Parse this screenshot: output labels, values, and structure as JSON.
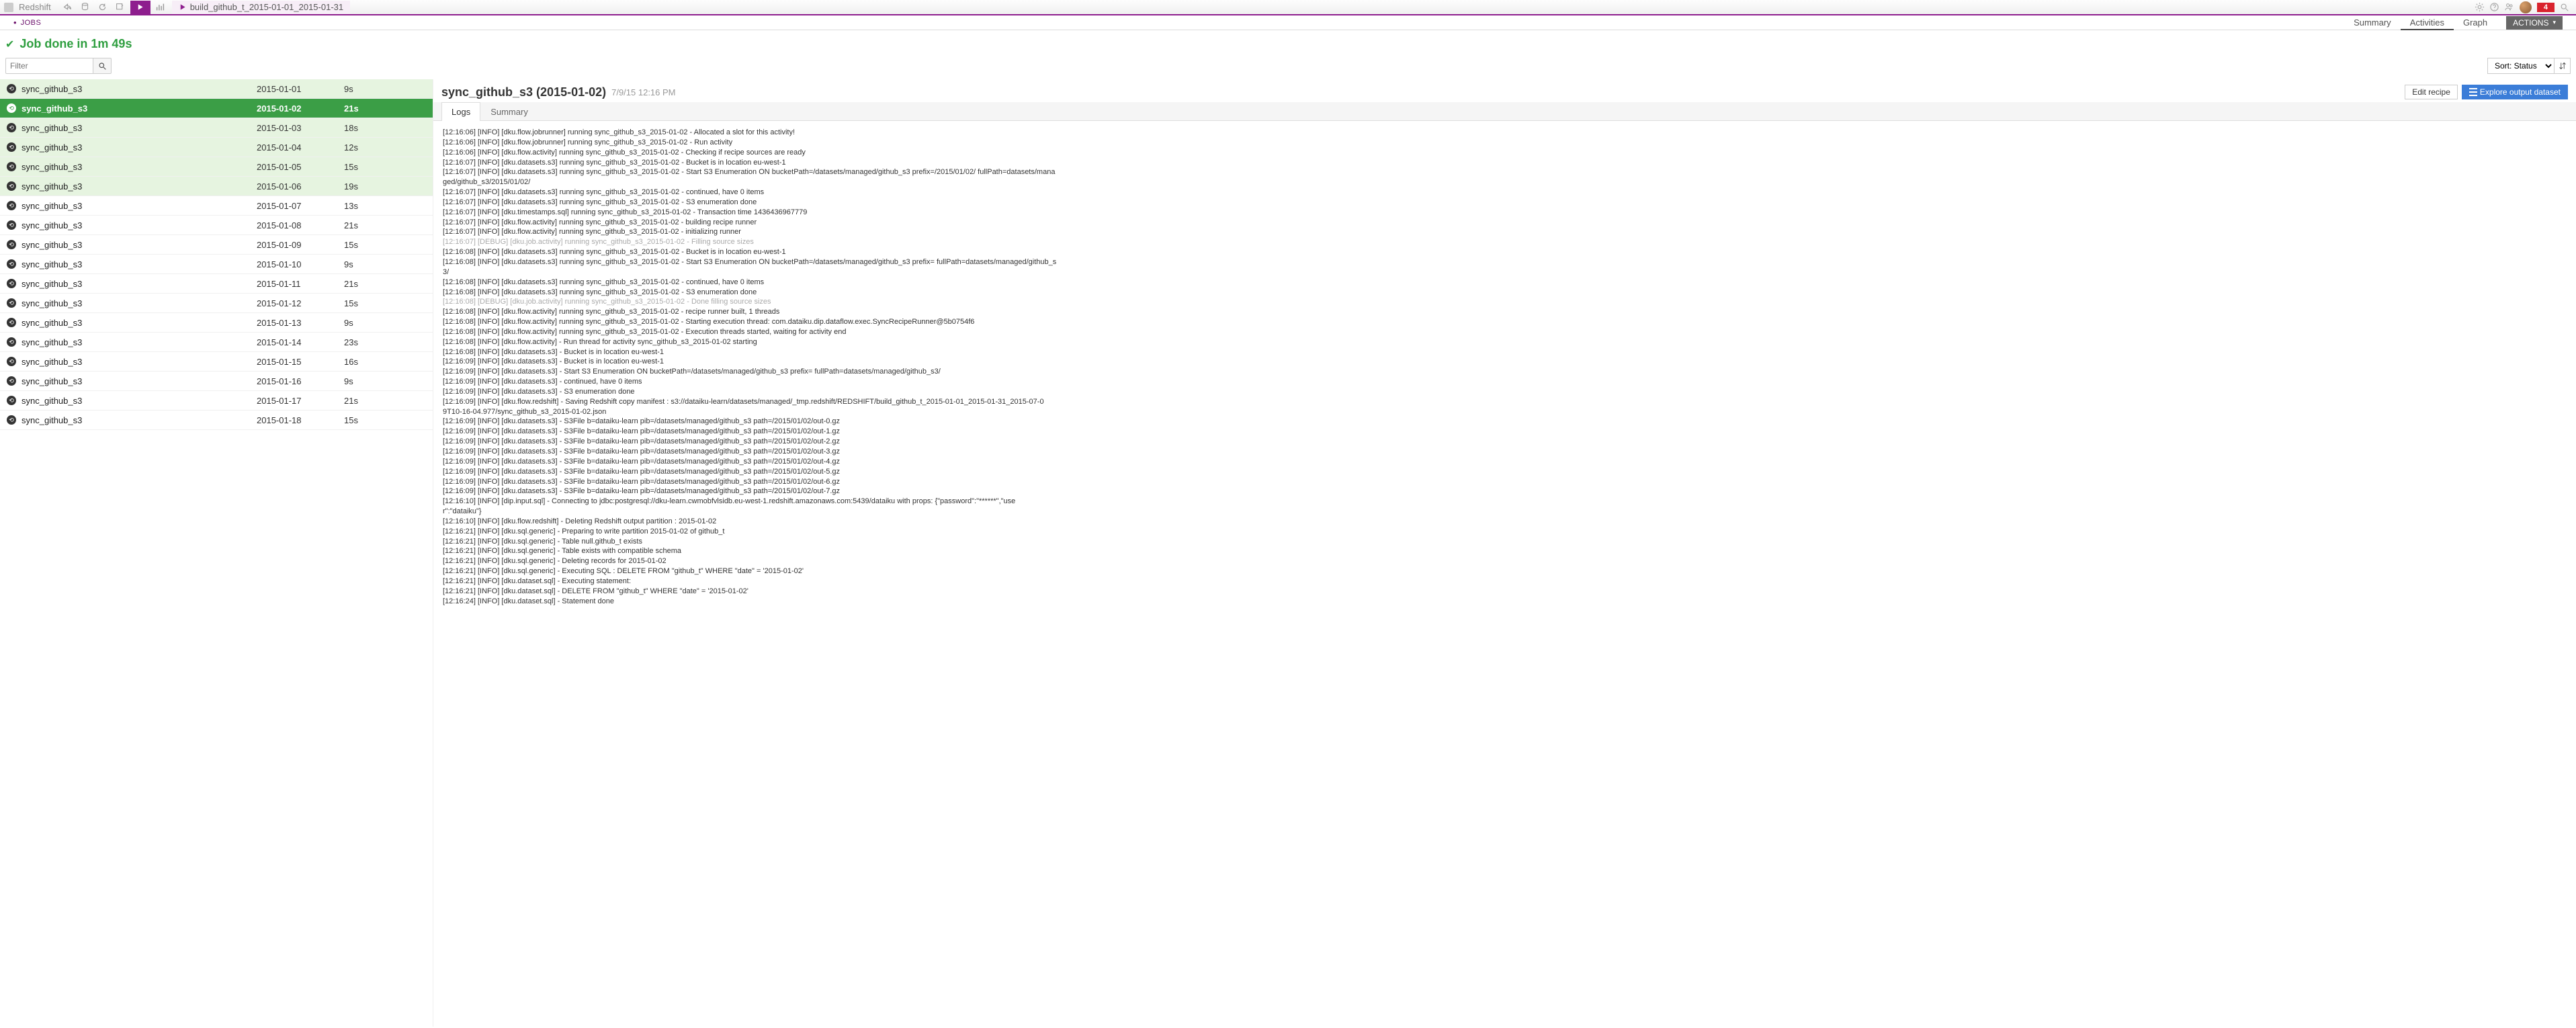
{
  "topbar": {
    "title": "Redshift",
    "crumb": "build_github_t_2015-01-01_2015-01-31",
    "badge": "4"
  },
  "subnav": {
    "jobs": "JOBS",
    "tabs": [
      "Summary",
      "Activities",
      "Graph"
    ],
    "active": "Activities",
    "actions": "ACTIONS"
  },
  "status": "Job done in 1m 49s",
  "filter": {
    "placeholder": "Filter"
  },
  "sort": {
    "label": "Sort: Status"
  },
  "activities": [
    {
      "name": "sync_github_s3",
      "date": "2015-01-01",
      "dur": "9s",
      "done": true
    },
    {
      "name": "sync_github_s3",
      "date": "2015-01-02",
      "dur": "21s",
      "done": true,
      "selected": true
    },
    {
      "name": "sync_github_s3",
      "date": "2015-01-03",
      "dur": "18s",
      "done": true
    },
    {
      "name": "sync_github_s3",
      "date": "2015-01-04",
      "dur": "12s",
      "done": true
    },
    {
      "name": "sync_github_s3",
      "date": "2015-01-05",
      "dur": "15s",
      "done": true
    },
    {
      "name": "sync_github_s3",
      "date": "2015-01-06",
      "dur": "19s",
      "done": true
    },
    {
      "name": "sync_github_s3",
      "date": "2015-01-07",
      "dur": "13s"
    },
    {
      "name": "sync_github_s3",
      "date": "2015-01-08",
      "dur": "21s"
    },
    {
      "name": "sync_github_s3",
      "date": "2015-01-09",
      "dur": "15s"
    },
    {
      "name": "sync_github_s3",
      "date": "2015-01-10",
      "dur": "9s"
    },
    {
      "name": "sync_github_s3",
      "date": "2015-01-11",
      "dur": "21s"
    },
    {
      "name": "sync_github_s3",
      "date": "2015-01-12",
      "dur": "15s"
    },
    {
      "name": "sync_github_s3",
      "date": "2015-01-13",
      "dur": "9s"
    },
    {
      "name": "sync_github_s3",
      "date": "2015-01-14",
      "dur": "23s"
    },
    {
      "name": "sync_github_s3",
      "date": "2015-01-15",
      "dur": "16s"
    },
    {
      "name": "sync_github_s3",
      "date": "2015-01-16",
      "dur": "9s"
    },
    {
      "name": "sync_github_s3",
      "date": "2015-01-17",
      "dur": "21s"
    },
    {
      "name": "sync_github_s3",
      "date": "2015-01-18",
      "dur": "15s"
    }
  ],
  "detail": {
    "title": "sync_github_s3 (2015-01-02)",
    "ts": "7/9/15 12:16 PM",
    "edit": "Edit recipe",
    "explore": "Explore output dataset",
    "tabs": [
      "Logs",
      "Summary"
    ],
    "active": "Logs",
    "log_lines": [
      "[12:16:06] [INFO] [dku.flow.jobrunner] running sync_github_s3_2015-01-02 - Allocated a slot for this activity!",
      "[12:16:06] [INFO] [dku.flow.jobrunner] running sync_github_s3_2015-01-02 - Run activity",
      "[12:16:06] [INFO] [dku.flow.activity] running sync_github_s3_2015-01-02 - Checking if recipe sources are ready",
      "[12:16:07] [INFO] [dku.datasets.s3] running sync_github_s3_2015-01-02 - Bucket is in location eu-west-1",
      "[12:16:07] [INFO] [dku.datasets.s3] running sync_github_s3_2015-01-02 - Start S3 Enumeration ON bucketPath=/datasets/managed/github_s3 prefix=/2015/01/02/ fullPath=datasets/mana",
      "ged/github_s3/2015/01/02/",
      "[12:16:07] [INFO] [dku.datasets.s3] running sync_github_s3_2015-01-02 - continued, have 0 items",
      "[12:16:07] [INFO] [dku.datasets.s3] running sync_github_s3_2015-01-02 - S3 enumeration done",
      "[12:16:07] [INFO] [dku.timestamps.sql] running sync_github_s3_2015-01-02 - Transaction time 1436436967779",
      "[12:16:07] [INFO] [dku.flow.activity] running sync_github_s3_2015-01-02 - building recipe runner",
      "[12:16:07] [INFO] [dku.flow.activity] running sync_github_s3_2015-01-02 - initializing runner",
      "[12:16:07] [DEBUG] [dku.job.activity] running sync_github_s3_2015-01-02 - Filling source sizes",
      "[12:16:08] [INFO] [dku.datasets.s3] running sync_github_s3_2015-01-02 - Bucket is in location eu-west-1",
      "[12:16:08] [INFO] [dku.datasets.s3] running sync_github_s3_2015-01-02 - Start S3 Enumeration ON bucketPath=/datasets/managed/github_s3 prefix= fullPath=datasets/managed/github_s",
      "3/",
      "[12:16:08] [INFO] [dku.datasets.s3] running sync_github_s3_2015-01-02 - continued, have 0 items",
      "[12:16:08] [INFO] [dku.datasets.s3] running sync_github_s3_2015-01-02 - S3 enumeration done",
      "[12:16:08] [DEBUG] [dku.job.activity] running sync_github_s3_2015-01-02 - Done filling source sizes",
      "[12:16:08] [INFO] [dku.flow.activity] running sync_github_s3_2015-01-02 - recipe runner built, 1 threads",
      "[12:16:08] [INFO] [dku.flow.activity] running sync_github_s3_2015-01-02 - Starting execution thread: com.dataiku.dip.dataflow.exec.SyncRecipeRunner@5b0754f6",
      "[12:16:08] [INFO] [dku.flow.activity] running sync_github_s3_2015-01-02 - Execution threads started, waiting for activity end",
      "[12:16:08] [INFO] [dku.flow.activity] - Run thread for activity sync_github_s3_2015-01-02 starting",
      "[12:16:08] [INFO] [dku.datasets.s3] - Bucket is in location eu-west-1",
      "[12:16:09] [INFO] [dku.datasets.s3] - Bucket is in location eu-west-1",
      "[12:16:09] [INFO] [dku.datasets.s3] - Start S3 Enumeration ON bucketPath=/datasets/managed/github_s3 prefix= fullPath=datasets/managed/github_s3/",
      "[12:16:09] [INFO] [dku.datasets.s3] - continued, have 0 items",
      "[12:16:09] [INFO] [dku.datasets.s3] - S3 enumeration done",
      "[12:16:09] [INFO] [dku.flow.redshift] - Saving Redshift copy manifest : s3://dataiku-learn/datasets/managed/_tmp.redshift/REDSHIFT/build_github_t_2015-01-01_2015-01-31_2015-07-0",
      "9T10-16-04.977/sync_github_s3_2015-01-02.json",
      "[12:16:09] [INFO] [dku.datasets.s3] - S3File b=dataiku-learn pib=/datasets/managed/github_s3 path=/2015/01/02/out-0.gz",
      "[12:16:09] [INFO] [dku.datasets.s3] - S3File b=dataiku-learn pib=/datasets/managed/github_s3 path=/2015/01/02/out-1.gz",
      "[12:16:09] [INFO] [dku.datasets.s3] - S3File b=dataiku-learn pib=/datasets/managed/github_s3 path=/2015/01/02/out-2.gz",
      "[12:16:09] [INFO] [dku.datasets.s3] - S3File b=dataiku-learn pib=/datasets/managed/github_s3 path=/2015/01/02/out-3.gz",
      "[12:16:09] [INFO] [dku.datasets.s3] - S3File b=dataiku-learn pib=/datasets/managed/github_s3 path=/2015/01/02/out-4.gz",
      "[12:16:09] [INFO] [dku.datasets.s3] - S3File b=dataiku-learn pib=/datasets/managed/github_s3 path=/2015/01/02/out-5.gz",
      "[12:16:09] [INFO] [dku.datasets.s3] - S3File b=dataiku-learn pib=/datasets/managed/github_s3 path=/2015/01/02/out-6.gz",
      "[12:16:09] [INFO] [dku.datasets.s3] - S3File b=dataiku-learn pib=/datasets/managed/github_s3 path=/2015/01/02/out-7.gz",
      "[12:16:10] [INFO] [dip.input.sql] - Connecting to jdbc:postgresql://dku-learn.cwmobfvlsidb.eu-west-1.redshift.amazonaws.com:5439/dataiku with props: {\"password\":\"******\",\"use",
      "r\":\"dataiku\"}",
      "[12:16:10] [INFO] [dku.flow.redshift] - Deleting Redshift output partition : 2015-01-02",
      "[12:16:21] [INFO] [dku.sql.generic] - Preparing to write partition 2015-01-02 of github_t",
      "[12:16:21] [INFO] [dku.sql.generic] - Table null.github_t exists",
      "[12:16:21] [INFO] [dku.sql.generic] - Table exists with compatible schema",
      "[12:16:21] [INFO] [dku.sql.generic] - Deleting records for 2015-01-02",
      "[12:16:21] [INFO] [dku.sql.generic] - Executing SQL : DELETE FROM \"github_t\" WHERE \"date\" = '2015-01-02'",
      "[12:16:21] [INFO] [dku.dataset.sql] - Executing statement:",
      "[12:16:21] [INFO] [dku.dataset.sql] - DELETE FROM \"github_t\" WHERE \"date\" = '2015-01-02'",
      "[12:16:24] [INFO] [dku.dataset.sql] - Statement done"
    ]
  }
}
